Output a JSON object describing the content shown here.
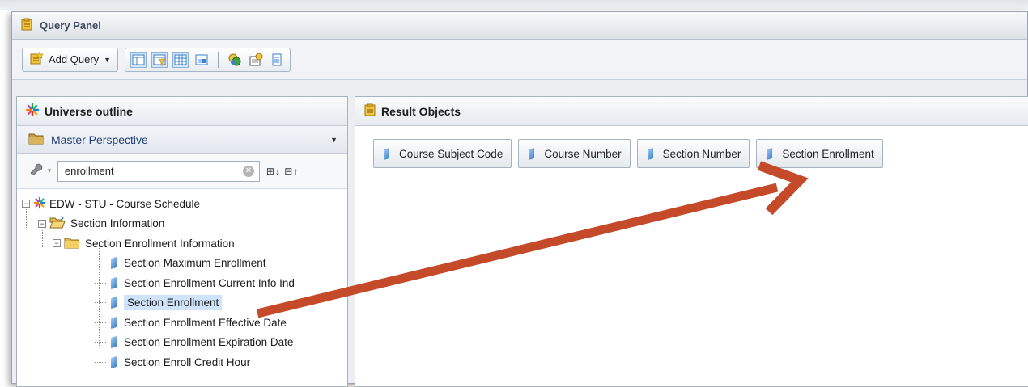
{
  "window": {
    "title": "Query Panel"
  },
  "toolbar": {
    "add_query_label": "Add Query"
  },
  "left_panel": {
    "title": "Universe outline",
    "perspective": "Master Perspective",
    "search_value": "enrollment"
  },
  "tree": {
    "root": "EDW - STU - Course Schedule",
    "folder1": "Section Information",
    "folder2": "Section Enrollment Information",
    "items": [
      "Section Maximum Enrollment",
      "Section Enrollment Current Info Ind",
      "Section Enrollment",
      "Section Enrollment Effective Date",
      "Section Enrollment Expiration Date",
      "Section Enroll Credit Hour"
    ],
    "selected_index": 2
  },
  "right_panel": {
    "title": "Result Objects",
    "objects": [
      "Course Subject Code",
      "Course Number",
      "Section Number",
      "Section Enrollment"
    ]
  },
  "colors": {
    "arrow": "#c44a2a",
    "selection": "#cfe4fb",
    "accent": "#1f3d7a"
  }
}
